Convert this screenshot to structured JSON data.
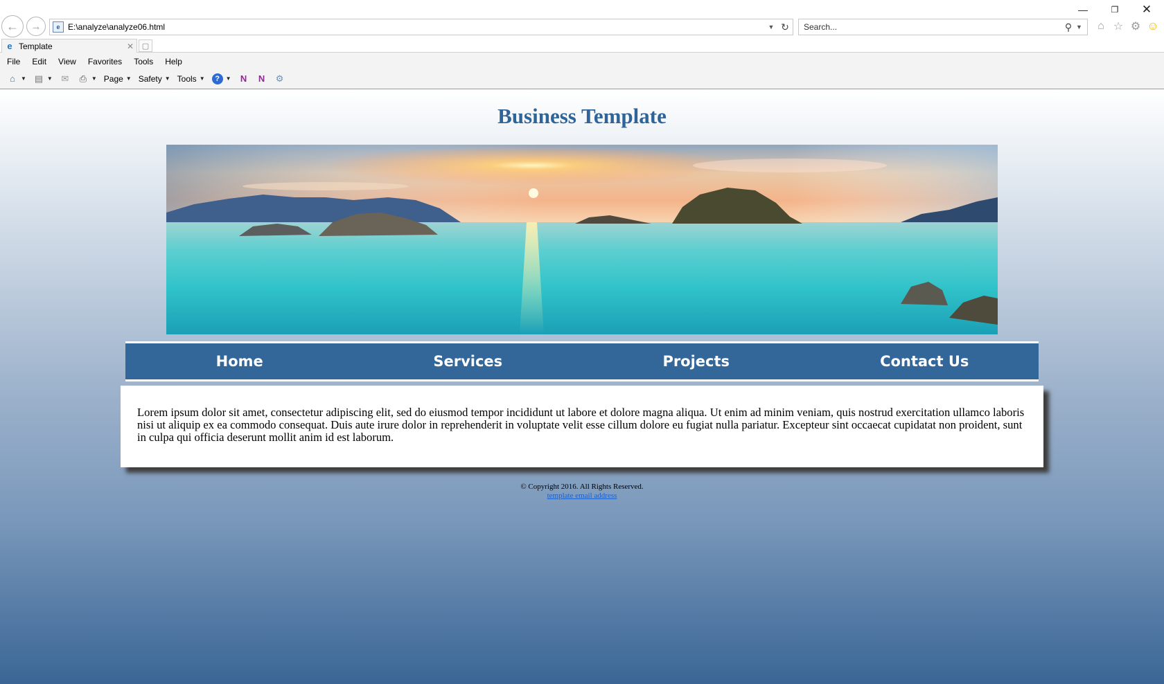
{
  "browser": {
    "address": "E:\\analyze\\analyze06.html",
    "search_placeholder": "Search...",
    "tab_title": "Template",
    "menu": [
      "File",
      "Edit",
      "View",
      "Favorites",
      "Tools",
      "Help"
    ],
    "command_bar": {
      "page_label": "Page",
      "safety_label": "Safety",
      "tools_label": "Tools"
    },
    "icons": {
      "back": "back-arrow-icon",
      "forward": "forward-arrow-icon",
      "refresh": "refresh-icon",
      "search": "search-icon",
      "home": "home-icon",
      "favorites": "star-icon",
      "settings": "gear-icon",
      "feedback": "smiley-icon"
    }
  },
  "site": {
    "title": "Business Template",
    "nav": [
      "Home",
      "Services",
      "Projects",
      "Contact Us"
    ],
    "content": "Lorem ipsum dolor sit amet, consectetur adipiscing elit, sed do eiusmod tempor incididunt ut labore et dolore magna aliqua. Ut enim ad minim veniam, quis nostrud exercitation ullamco laboris nisi ut aliquip ex ea commodo consequat. Duis aute irure dolor in reprehenderit in voluptate velit esse cillum dolore eu fugiat nulla pariatur. Excepteur sint occaecat cupidatat non proident, sunt in culpa qui officia deserunt mollit anim id est laborum.",
    "footer_copyright": "© Copyright 2016. All Rights Reserved.",
    "footer_email_link": "template email address"
  },
  "colors": {
    "title": "#2e6497",
    "navbar": "#336699",
    "footer_link": "#1a5fc7"
  }
}
